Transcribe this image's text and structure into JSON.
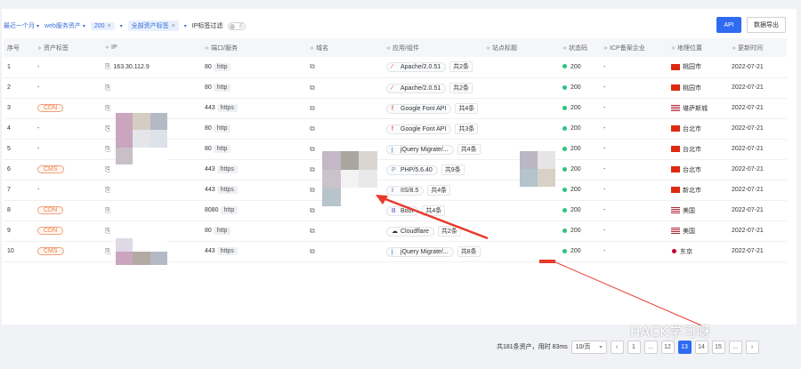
{
  "filters": {
    "time": "最近一个月",
    "assets": "web服务资产",
    "status_tag": "200",
    "label_tag": "全部资产标签",
    "switch_label": "IP标签过滤",
    "switch_state": "否"
  },
  "buttons": {
    "api": "API",
    "export": "数据导出"
  },
  "columns": [
    "序号",
    "资产标签",
    "IP",
    "端口/服务",
    "域名",
    "应用/组件",
    "站点标题",
    "状态码",
    "ICP备案企业",
    "地理位置",
    "更新时间"
  ],
  "rows": [
    {
      "no": "1",
      "tag": "-",
      "ip": "163.30.112.9",
      "port": "80",
      "svc": "http",
      "app": "Apache/2.0.51",
      "app_count": "共2条",
      "app_icon": "apache",
      "status": "200",
      "icp": "-",
      "flag": "cn",
      "geo": "桃园市",
      "date": "2022-07-21"
    },
    {
      "no": "2",
      "tag": "-",
      "ip": "",
      "port": "80",
      "svc": "http",
      "app": "Apache/2.0.51",
      "app_count": "共2条",
      "app_icon": "apache",
      "status": "200",
      "icp": "-",
      "flag": "cn",
      "geo": "桃园市",
      "date": "2022-07-21"
    },
    {
      "no": "3",
      "tag": "CDN",
      "ip": "",
      "port": "443",
      "svc": "https",
      "app": "Google Font API",
      "app_count": "共4条",
      "app_icon": "google",
      "status": "200",
      "icp": "-",
      "flag": "us",
      "geo": "堪萨斯城",
      "date": "2022-07-21"
    },
    {
      "no": "4",
      "tag": "-",
      "ip": "",
      "port": "80",
      "svc": "http",
      "app": "Google Font API",
      "app_count": "共3条",
      "app_icon": "google",
      "status": "200",
      "icp": "-",
      "flag": "cn",
      "geo": "台北市",
      "date": "2022-07-21"
    },
    {
      "no": "5",
      "tag": "-",
      "ip": "",
      "port": "80",
      "svc": "http",
      "app": "jQuery Migrate/...",
      "app_count": "共4条",
      "app_icon": "jquery",
      "status": "200",
      "icp": "-",
      "flag": "cn",
      "geo": "台北市",
      "date": "2022-07-21"
    },
    {
      "no": "6",
      "tag": "CMS",
      "ip": "",
      "port": "443",
      "svc": "https",
      "app": "PHP/5.6.40",
      "app_count": "共9条",
      "app_icon": "php",
      "status": "200",
      "icp": "-",
      "flag": "cn",
      "geo": "台北市",
      "date": "2022-07-21"
    },
    {
      "no": "7",
      "tag": "-",
      "ip": "",
      "port": "443",
      "svc": "https",
      "app": "IIS/8.5",
      "app_count": "共4条",
      "app_icon": "iis",
      "status": "200",
      "icp": "-",
      "flag": "cn",
      "geo": "新北市",
      "date": "2022-07-21"
    },
    {
      "no": "8",
      "tag": "CDN",
      "ip": "",
      "port": "8080",
      "svc": "http",
      "app": "Boot",
      "app_count": "共4条",
      "app_icon": "bootstrap",
      "status": "200",
      "icp": "-",
      "flag": "us",
      "geo": "美国",
      "date": "2022-07-21"
    },
    {
      "no": "9",
      "tag": "CDN",
      "ip": "",
      "port": "80",
      "svc": "http",
      "app": "Cloudflare",
      "app_count": "共2条",
      "app_icon": "cloudflare",
      "status": "200",
      "icp": "-",
      "flag": "us",
      "geo": "美国",
      "date": "2022-07-21"
    },
    {
      "no": "10",
      "tag": "CMS",
      "ip": "",
      "port": "443",
      "svc": "https",
      "app": "jQuery Migrate/...",
      "app_count": "共8条",
      "app_icon": "jquery",
      "status": "200",
      "icp": "-",
      "flag": "jp",
      "geo": "东京",
      "date": "2022-07-21"
    }
  ],
  "pagination": {
    "summary": "共181条资产，用时 83ms",
    "page_size": "10/页",
    "pages": [
      "1",
      "...",
      "12",
      "13",
      "14",
      "15",
      "..."
    ],
    "active_page": "13"
  },
  "watermark": "HACK学习呀",
  "colors": {
    "primary": "#2f6bf0",
    "annotation": "#e8392b",
    "status_ok": "#2ec27e",
    "tag_orange": "#f07c45"
  }
}
